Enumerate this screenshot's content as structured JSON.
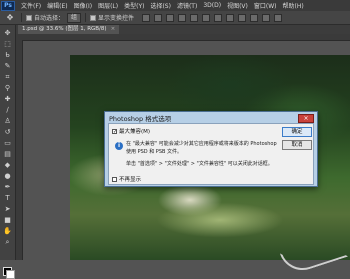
{
  "app": {
    "logo": "Ps",
    "menu": [
      "文件(F)",
      "编辑(E)",
      "图像(I)",
      "图层(L)",
      "类型(Y)",
      "选择(S)",
      "滤镜(T)",
      "3D(D)",
      "视图(V)",
      "窗口(W)",
      "帮助(H)"
    ]
  },
  "options": {
    "auto_select_label": "自动选择：",
    "auto_select_value": "组",
    "show_transform_label": "显示变换控件"
  },
  "document": {
    "tab_label": "1.psd @ 33.6% (图层 1, RGB/8)",
    "close": "×"
  },
  "toolbar": {
    "icons": [
      "move-tool-icon",
      "marquee-tool-icon",
      "lasso-tool-icon",
      "quick-select-icon",
      "crop-tool-icon",
      "eyedropper-icon",
      "healing-brush-icon",
      "brush-tool-icon",
      "clone-stamp-icon",
      "history-brush-icon",
      "eraser-icon",
      "gradient-icon",
      "blur-tool-icon",
      "dodge-tool-icon",
      "pen-tool-icon",
      "type-tool-icon",
      "path-select-icon",
      "shape-tool-icon",
      "hand-tool-icon",
      "zoom-tool-icon"
    ],
    "foreground_color": "#000000",
    "background_color": "#ffffff"
  },
  "dialog": {
    "title": "Photoshop 格式选项",
    "close": "×",
    "maximize_label": "最大兼容(M)",
    "line1": "在 \"最大兼容\" 可能会减少对其它应用程序或将来版本的 Photoshop",
    "line2": "使用 PSD 和 PSB 文件。",
    "line3": "单击 \"首选项\" > \"文件处理\" > \"文件兼容性\" 可以关闭此对话框。",
    "dont_show_label": "不再显示",
    "ok_label": "确定",
    "cancel_label": "取消",
    "info_glyph": "i",
    "check_glyph": "✓"
  }
}
